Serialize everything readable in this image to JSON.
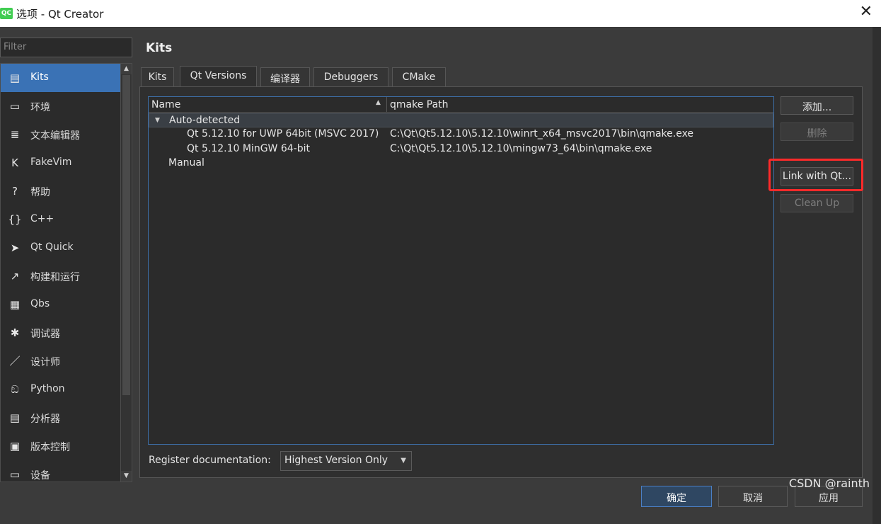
{
  "titlebar": {
    "app_icon": "QC",
    "title": "选项 - Qt Creator",
    "close_glyph": "✕"
  },
  "filter": {
    "placeholder": "Filter"
  },
  "nav": {
    "items": [
      {
        "label": "Kits",
        "icon": "kits-icon",
        "glyph": "▤"
      },
      {
        "label": "环境",
        "icon": "monitor-icon",
        "glyph": "▭"
      },
      {
        "label": "文本编辑器",
        "icon": "text-editor-icon",
        "glyph": "≣"
      },
      {
        "label": "FakeVim",
        "icon": "fakevim-icon",
        "glyph": "K"
      },
      {
        "label": "帮助",
        "icon": "help-icon",
        "glyph": "?"
      },
      {
        "label": "C++",
        "icon": "cpp-braces-icon",
        "glyph": "{}"
      },
      {
        "label": "Qt Quick",
        "icon": "paper-plane-icon",
        "glyph": "➤"
      },
      {
        "label": "构建和运行",
        "icon": "hammer-icon",
        "glyph": "↗"
      },
      {
        "label": "Qbs",
        "icon": "grid-icon",
        "glyph": "▦"
      },
      {
        "label": "调试器",
        "icon": "bug-icon",
        "glyph": "✱"
      },
      {
        "label": "设计师",
        "icon": "pen-icon",
        "glyph": "／"
      },
      {
        "label": "Python",
        "icon": "python-icon",
        "glyph": "ඞ"
      },
      {
        "label": "分析器",
        "icon": "analyzer-icon",
        "glyph": "▤"
      },
      {
        "label": "版本控制",
        "icon": "version-control-icon",
        "glyph": "▣"
      },
      {
        "label": "设备",
        "icon": "device-icon",
        "glyph": "▭"
      }
    ],
    "scroll_up": "▲",
    "scroll_down": "▼"
  },
  "page": {
    "title": "Kits"
  },
  "tabs": [
    "Kits",
    "Qt Versions",
    "编译器",
    "Debuggers",
    "CMake"
  ],
  "tree": {
    "columns": [
      "Name",
      "qmake Path"
    ],
    "sort_glyph": "▲",
    "expand_glyph": "▼",
    "auto_detected": "Auto-detected",
    "versions": [
      {
        "name": "Qt 5.12.10 for UWP 64bit (MSVC 2017)",
        "path": "C:\\Qt\\Qt5.12.10\\5.12.10\\winrt_x64_msvc2017\\bin\\qmake.exe"
      },
      {
        "name": "Qt 5.12.10 MinGW 64-bit",
        "path": "C:\\Qt\\Qt5.12.10\\5.12.10\\mingw73_64\\bin\\qmake.exe"
      }
    ],
    "manual": "Manual"
  },
  "side_buttons": {
    "add": "添加...",
    "remove": "删除",
    "link": "Link with Qt...",
    "cleanup": "Clean Up"
  },
  "register_doc": {
    "label": "Register documentation:",
    "value": "Highest Version Only",
    "arrow": "▼"
  },
  "footer": {
    "ok": "确定",
    "cancel": "取消",
    "apply": "应用"
  },
  "watermark": "CSDN @rainth"
}
